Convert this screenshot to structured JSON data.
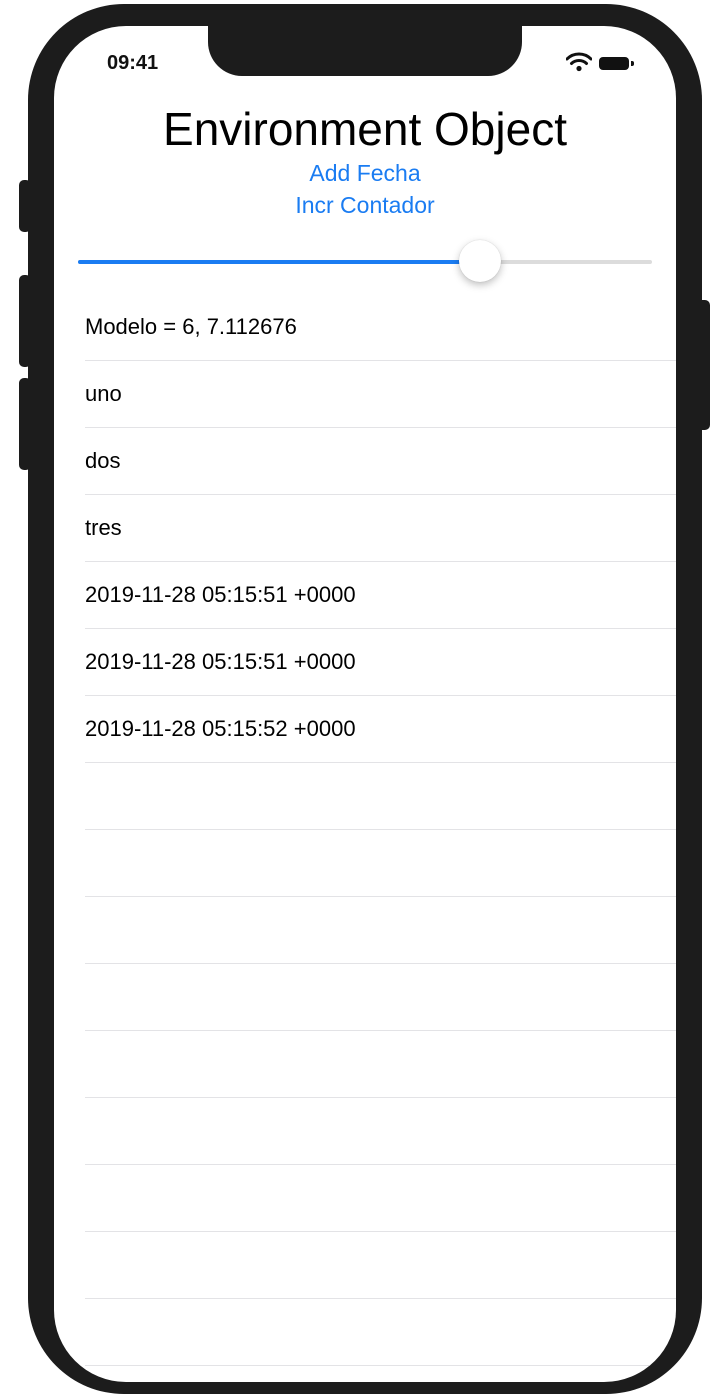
{
  "status_bar": {
    "time": "09:41"
  },
  "header": {
    "title": "Environment Object",
    "add_fecha_label": "Add Fecha",
    "incr_contador_label": "Incr Contador"
  },
  "slider": {
    "value_fraction": 0.7
  },
  "list": {
    "rows": [
      "Modelo = 6, 7.112676",
      "uno",
      "dos",
      "tres",
      "2019-11-28 05:15:51 +0000",
      "2019-11-28 05:15:51 +0000",
      "2019-11-28 05:15:52 +0000",
      "",
      "",
      "",
      "",
      "",
      "",
      "",
      "",
      ""
    ]
  },
  "colors": {
    "accent": "#1a7cf2",
    "device_frame": "#1c1c1c",
    "separator": "#e3e3e6"
  }
}
